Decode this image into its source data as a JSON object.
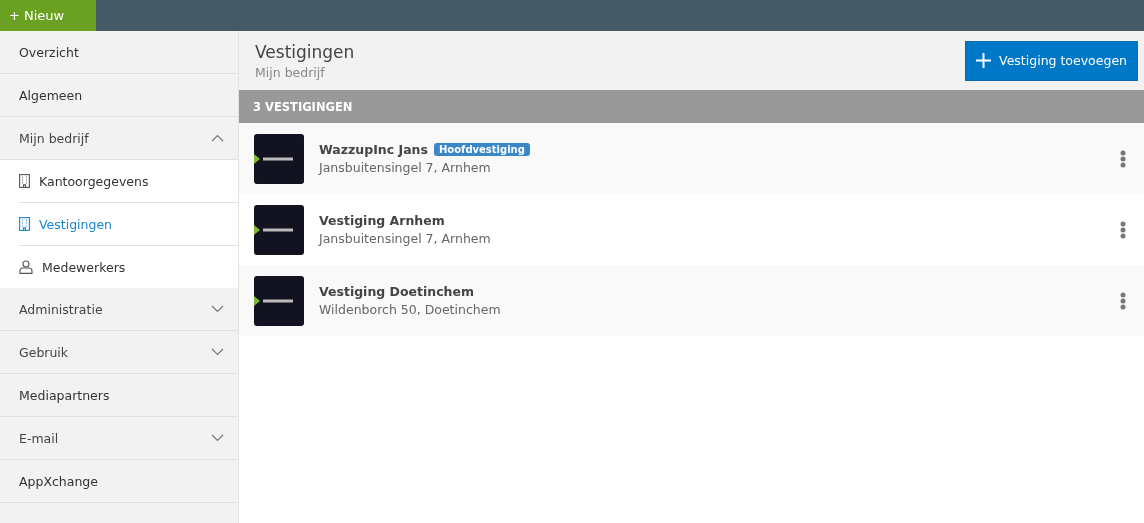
{
  "topbar": {
    "new_button": "+ Nieuw"
  },
  "sidebar": {
    "items": [
      {
        "label": "Overzicht",
        "kind": "link"
      },
      {
        "label": "Algemeen",
        "kind": "link"
      },
      {
        "label": "Mijn bedrijf",
        "kind": "group",
        "expanded": true,
        "children": [
          {
            "label": "Kantoorgegevens",
            "kind": "building",
            "selected": false
          },
          {
            "label": "Vestigingen",
            "kind": "building",
            "selected": true
          },
          {
            "label": "Medewerkers",
            "kind": "person",
            "selected": false
          }
        ]
      },
      {
        "label": "Administratie",
        "kind": "group",
        "expanded": false
      },
      {
        "label": "Gebruik",
        "kind": "group",
        "expanded": false
      },
      {
        "label": "Mediapartners",
        "kind": "link"
      },
      {
        "label": "E-mail",
        "kind": "group",
        "expanded": false
      },
      {
        "label": "AppXchange",
        "kind": "link"
      }
    ]
  },
  "header": {
    "title": "Vestigingen",
    "subtitle": "Mijn bedrijf",
    "add_button": "Vestiging toevoegen"
  },
  "list": {
    "count": "3 VESTIGINGEN",
    "rows": [
      {
        "name": "WazzupInc Jans",
        "badge": "Hoofdvestiging",
        "address": "Jansbuitensingel 7, Arnhem"
      },
      {
        "name": "Vestiging Arnhem",
        "address": "Jansbuitensingel 7, Arnhem"
      },
      {
        "name": "Vestiging Doetinchem",
        "address": "Wildenborch 50, Doetinchem"
      }
    ]
  }
}
